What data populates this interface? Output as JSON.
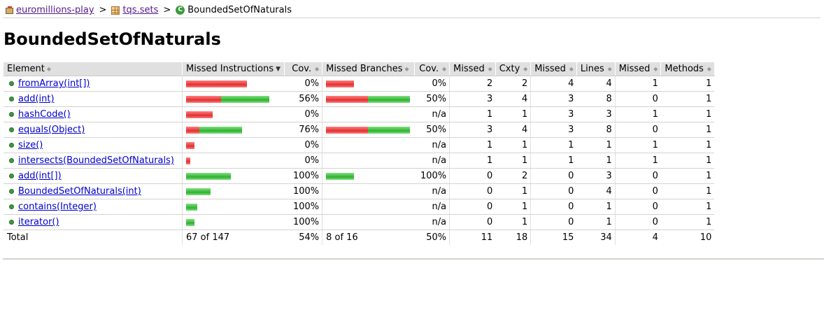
{
  "breadcrumb": {
    "session": "euromillions-play",
    "package": "tqs.sets",
    "class": "BoundedSetOfNaturals",
    "separator": ">"
  },
  "page_title": "BoundedSetOfNaturals",
  "table": {
    "headers": {
      "element": "Element",
      "missed_instructions": "Missed Instructions",
      "cov1": "Cov.",
      "missed_branches": "Missed Branches",
      "cov2": "Cov.",
      "missed_cxty": "Missed",
      "cxty": "Cxty",
      "missed_lines": "Missed",
      "lines": "Lines",
      "missed_methods": "Missed",
      "methods": "Methods"
    },
    "rows": [
      {
        "name": "fromArray(int[])",
        "instr_red": 87,
        "instr_green": 0,
        "instr_cov": "0%",
        "br_red": 40,
        "br_green": 0,
        "br_cov": "0%",
        "missed_cxty": "2",
        "cxty": "2",
        "missed_lines": "4",
        "lines": "4",
        "missed_methods": "1",
        "methods": "1"
      },
      {
        "name": "add(int)",
        "instr_red": 50,
        "instr_green": 69,
        "instr_cov": "56%",
        "br_red": 60,
        "br_green": 60,
        "br_cov": "50%",
        "missed_cxty": "3",
        "cxty": "4",
        "missed_lines": "3",
        "lines": "8",
        "missed_methods": "0",
        "methods": "1"
      },
      {
        "name": "hashCode()",
        "instr_red": 38,
        "instr_green": 0,
        "instr_cov": "0%",
        "br_red": 0,
        "br_green": 0,
        "br_cov": "n/a",
        "missed_cxty": "1",
        "cxty": "1",
        "missed_lines": "3",
        "lines": "3",
        "missed_methods": "1",
        "methods": "1"
      },
      {
        "name": "equals(Object)",
        "instr_red": 19,
        "instr_green": 61,
        "instr_cov": "76%",
        "br_red": 60,
        "br_green": 60,
        "br_cov": "50%",
        "missed_cxty": "3",
        "cxty": "4",
        "missed_lines": "3",
        "lines": "8",
        "missed_methods": "0",
        "methods": "1"
      },
      {
        "name": "size()",
        "instr_red": 12,
        "instr_green": 0,
        "instr_cov": "0%",
        "br_red": 0,
        "br_green": 0,
        "br_cov": "n/a",
        "missed_cxty": "1",
        "cxty": "1",
        "missed_lines": "1",
        "lines": "1",
        "missed_methods": "1",
        "methods": "1"
      },
      {
        "name": "intersects(BoundedSetOfNaturals)",
        "instr_red": 6,
        "instr_green": 0,
        "instr_cov": "0%",
        "br_red": 0,
        "br_green": 0,
        "br_cov": "n/a",
        "missed_cxty": "1",
        "cxty": "1",
        "missed_lines": "1",
        "lines": "1",
        "missed_methods": "1",
        "methods": "1"
      },
      {
        "name": "add(int[])",
        "instr_red": 0,
        "instr_green": 64,
        "instr_cov": "100%",
        "br_red": 0,
        "br_green": 40,
        "br_cov": "100%",
        "missed_cxty": "0",
        "cxty": "2",
        "missed_lines": "0",
        "lines": "3",
        "missed_methods": "0",
        "methods": "1"
      },
      {
        "name": "BoundedSetOfNaturals(int)",
        "instr_red": 0,
        "instr_green": 35,
        "instr_cov": "100%",
        "br_red": 0,
        "br_green": 0,
        "br_cov": "n/a",
        "missed_cxty": "0",
        "cxty": "1",
        "missed_lines": "0",
        "lines": "4",
        "missed_methods": "0",
        "methods": "1"
      },
      {
        "name": "contains(Integer)",
        "instr_red": 0,
        "instr_green": 16,
        "instr_cov": "100%",
        "br_red": 0,
        "br_green": 0,
        "br_cov": "n/a",
        "missed_cxty": "0",
        "cxty": "1",
        "missed_lines": "0",
        "lines": "1",
        "missed_methods": "0",
        "methods": "1"
      },
      {
        "name": "iterator()",
        "instr_red": 0,
        "instr_green": 12,
        "instr_cov": "100%",
        "br_red": 0,
        "br_green": 0,
        "br_cov": "n/a",
        "missed_cxty": "0",
        "cxty": "1",
        "missed_lines": "0",
        "lines": "1",
        "missed_methods": "0",
        "methods": "1"
      }
    ],
    "total": {
      "label": "Total",
      "instructions": "67 of 147",
      "instr_cov": "54%",
      "branches": "8 of 16",
      "br_cov": "50%",
      "missed_cxty": "11",
      "cxty": "18",
      "missed_lines": "15",
      "lines": "34",
      "missed_methods": "4",
      "methods": "10"
    }
  },
  "colors": {
    "missed": "#e03030",
    "covered": "#30b030",
    "header_bg": "#e0e0e0",
    "link": "#0000cc"
  },
  "icons": {
    "session": "session-icon",
    "package": "package-icon",
    "class": "class-icon",
    "method": "method-icon"
  }
}
